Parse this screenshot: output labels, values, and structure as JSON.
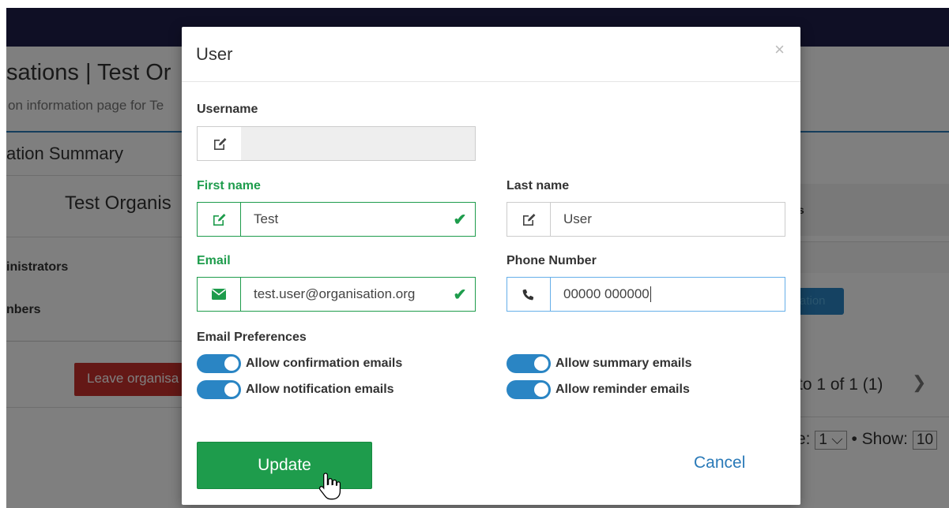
{
  "background": {
    "title": "sations | Test Or",
    "subtitle": "on information page for Te",
    "summary": "ation Summary",
    "org_name": "Test Organis",
    "administrators": "inistrators",
    "members": "nbers",
    "leave_button": "Leave organisa",
    "right_header_fragment": "s",
    "badge_fragment": "ation",
    "paging": "to 1 of 1 (1)",
    "page_label": "e:",
    "page_value": "1",
    "show_label": "• Show:",
    "show_value": "10"
  },
  "modal": {
    "title": "User",
    "close_glyph": "×",
    "username": {
      "label": "Username",
      "value": ""
    },
    "first_name": {
      "label": "First name",
      "value": "Test"
    },
    "last_name": {
      "label": "Last name",
      "value": "User"
    },
    "email": {
      "label": "Email",
      "value": "test.user@organisation.org"
    },
    "phone": {
      "label": "Phone Number",
      "value": "00000 000000"
    },
    "email_preferences": {
      "label": "Email Preferences",
      "options": [
        {
          "label": "Allow confirmation emails",
          "enabled": true
        },
        {
          "label": "Allow notification emails",
          "enabled": true
        },
        {
          "label": "Allow summary emails",
          "enabled": true
        },
        {
          "label": "Allow reminder emails",
          "enabled": true
        }
      ]
    },
    "update_label": "Update",
    "cancel_label": "Cancel"
  },
  "colors": {
    "success": "#1e9c4c",
    "primary": "#2a85c4",
    "link": "#2a7ab8",
    "topbar": "#1f1f4a"
  }
}
